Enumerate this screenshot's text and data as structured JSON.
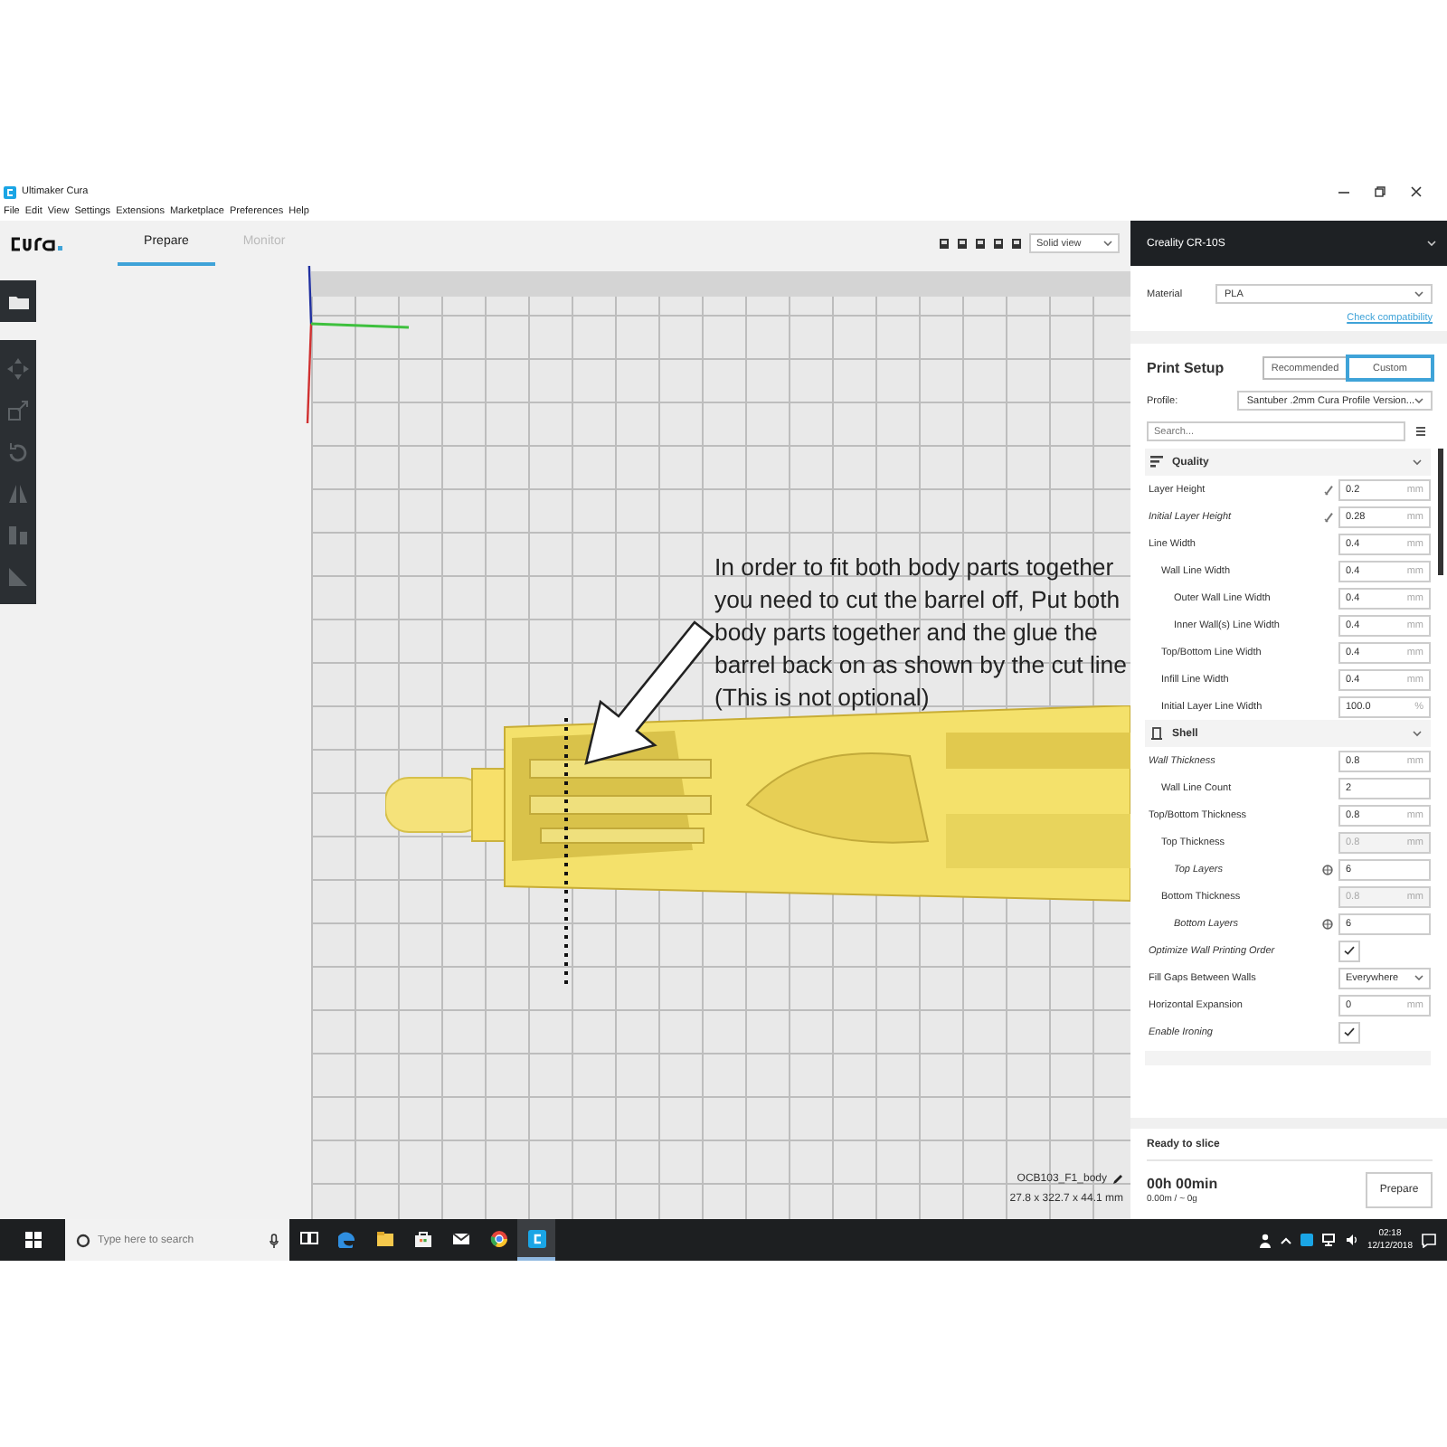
{
  "window": {
    "title": "Ultimaker Cura"
  },
  "menu": [
    "File",
    "Edit",
    "View",
    "Settings",
    "Extensions",
    "Marketplace",
    "Preferences",
    "Help"
  ],
  "stages": [
    {
      "label": "Prepare",
      "selected": true
    },
    {
      "label": "Monitor",
      "selected": false
    }
  ],
  "view_mode": "Solid view",
  "tools": [
    {
      "kind": "open",
      "disabled": false
    },
    {
      "kind": "move",
      "disabled": true
    },
    {
      "kind": "scale",
      "disabled": true
    },
    {
      "kind": "rotate",
      "disabled": true
    },
    {
      "kind": "mirror",
      "disabled": true
    },
    {
      "kind": "per-model",
      "disabled": true
    },
    {
      "kind": "support-blocker",
      "disabled": true
    }
  ],
  "annotation": {
    "lines": [
      "In order to fit both body parts together",
      "you need to cut the barrel off, Put both",
      "body parts together and the glue the",
      "barrel back on as shown by the cut line",
      "(This is not optional)"
    ]
  },
  "object_info": {
    "name": "OCB103_F1_body",
    "dimensions": "27.8 x 322.7 x 44.1 mm"
  },
  "printer": {
    "name": "Creality CR-10S"
  },
  "material": {
    "label": "Material",
    "value": "PLA",
    "link": "Check compatibility"
  },
  "print_setup": {
    "title": "Print Setup",
    "modes": [
      {
        "label": "Recommended",
        "selected": false
      },
      {
        "label": "Custom",
        "selected": true
      }
    ],
    "profile_label": "Profile:",
    "profile": "Santuber .2mm Cura Profile Version...",
    "search_placeholder": "Search..."
  },
  "sections": [
    {
      "label": "Quality",
      "expanded": true,
      "settings": [
        {
          "label": "Layer Height",
          "kind": "number",
          "value": "0.2",
          "unit": "mm",
          "modified": false,
          "linked": true
        },
        {
          "label": "Initial Layer Height",
          "kind": "number",
          "value": "0.28",
          "unit": "mm",
          "modified": true,
          "linked": true
        },
        {
          "label": "Line Width",
          "kind": "number",
          "value": "0.4",
          "unit": "mm",
          "modified": false,
          "children": [
            {
              "label": "Wall Line Width",
              "kind": "number",
              "value": "0.4",
              "unit": "mm",
              "modified": false,
              "children": [
                {
                  "label": "Outer Wall Line Width",
                  "kind": "number",
                  "value": "0.4",
                  "unit": "mm",
                  "modified": false
                },
                {
                  "label": "Inner Wall(s) Line Width",
                  "kind": "number",
                  "value": "0.4",
                  "unit": "mm",
                  "modified": false
                }
              ]
            },
            {
              "label": "Top/Bottom Line Width",
              "kind": "number",
              "value": "0.4",
              "unit": "mm",
              "modified": false
            },
            {
              "label": "Infill Line Width",
              "kind": "number",
              "value": "0.4",
              "unit": "mm",
              "modified": false
            },
            {
              "label": "Initial Layer Line Width",
              "kind": "number",
              "value": "100.0",
              "unit": "%",
              "modified": false
            }
          ]
        }
      ]
    },
    {
      "label": "Shell",
      "expanded": true,
      "settings": [
        {
          "label": "Wall Thickness",
          "kind": "number",
          "value": "0.8",
          "unit": "mm",
          "modified": true,
          "children": [
            {
              "label": "Wall Line Count",
              "kind": "number",
              "value": "2",
              "modified": false
            }
          ]
        },
        {
          "label": "Top/Bottom Thickness",
          "kind": "number",
          "value": "0.8",
          "unit": "mm",
          "modified": false,
          "children": [
            {
              "label": "Top Thickness",
              "kind": "number",
              "value": "0.8",
              "unit": "mm",
              "modified": false,
              "disabled": true,
              "children": [
                {
                  "label": "Top Layers",
                  "kind": "number",
                  "value": "6",
                  "modified": true,
                  "calculated": true
                }
              ]
            },
            {
              "label": "Bottom Thickness",
              "kind": "number",
              "value": "0.8",
              "unit": "mm",
              "modified": false,
              "disabled": true,
              "children": [
                {
                  "label": "Bottom Layers",
                  "kind": "number",
                  "value": "6",
                  "modified": true,
                  "calculated": true
                }
              ]
            }
          ]
        },
        {
          "label": "Optimize Wall Printing Order",
          "kind": "checkbox",
          "checked": true,
          "modified": true
        },
        {
          "label": "Fill Gaps Between Walls",
          "kind": "dropdown",
          "value": "Everywhere",
          "modified": false
        },
        {
          "label": "Horizontal Expansion",
          "kind": "number",
          "value": "0",
          "unit": "mm",
          "modified": false
        },
        {
          "label": "Enable Ironing",
          "kind": "checkbox",
          "checked": true,
          "modified": true
        }
      ]
    }
  ],
  "slice": {
    "status": "Ready to slice",
    "time": "00h 00min",
    "usage": "0.00m / ~ 0g",
    "button": "Prepare"
  },
  "taskbar": {
    "search_placeholder": "Type here to search",
    "apps": [
      {
        "kind": "task-view",
        "selected": false
      },
      {
        "kind": "edge",
        "selected": false
      },
      {
        "kind": "explorer",
        "selected": false
      },
      {
        "kind": "store",
        "selected": false
      },
      {
        "kind": "mail",
        "selected": false
      },
      {
        "kind": "chrome",
        "selected": false
      },
      {
        "kind": "cura",
        "selected": true
      }
    ],
    "time": "02:18",
    "date": "12/12/2018"
  }
}
